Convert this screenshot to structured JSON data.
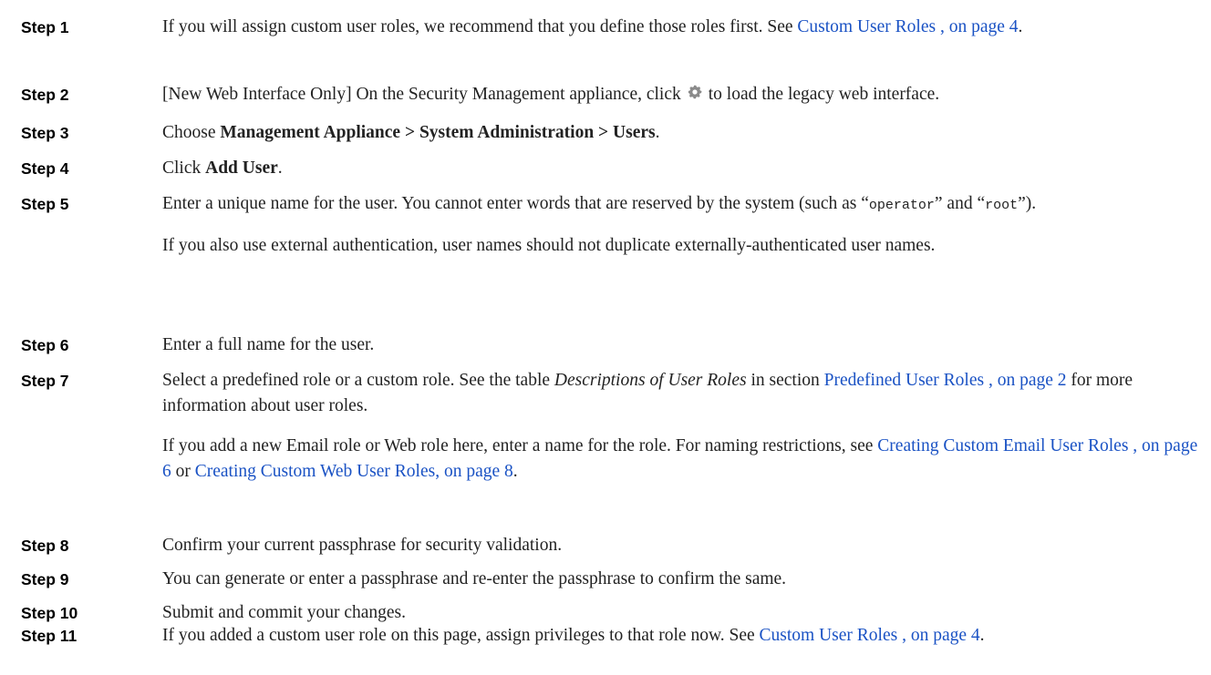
{
  "steps": [
    {
      "label": "Step 1",
      "p1": {
        "a": "If you will assign custom user roles, we recommend that you define those roles first. See ",
        "link": "Custom User Roles , on page 4",
        "b": "."
      }
    },
    {
      "label": "Step 2",
      "p1": {
        "a": "[New Web Interface Only] On the Security Management appliance, click",
        "b": "to load the legacy web interface."
      }
    },
    {
      "label": "Step 3",
      "p1": {
        "a": "Choose ",
        "bold": "Management Appliance > System Administration > Users",
        "b": "."
      }
    },
    {
      "label": "Step 4",
      "p1": {
        "a": "Click ",
        "bold": "Add User",
        "b": "."
      }
    },
    {
      "label": "Step 5",
      "p1": {
        "a": "Enter a unique name for the user. You cannot enter words that are reserved by the system (such as “",
        "code1": "operator",
        "b": "” and “",
        "code2": "root",
        "c": "”)."
      },
      "p2": "If you also use external authentication, user names should not duplicate externally-authenticated user names."
    },
    {
      "label": "Step 6",
      "p1": "Enter a full name for the user."
    },
    {
      "label": "Step 7",
      "p1": {
        "a": "Select a predefined role or a custom role. See the table ",
        "italic": "Descriptions of User Roles",
        "b": " in section ",
        "link": "Predefined User Roles , on page 2",
        "c": " for more information about user roles."
      },
      "p2": {
        "a": "If you add a new Email role or Web role here, enter a name for the role. For naming restrictions, see ",
        "link1": "Creating Custom Email User Roles , on page 6",
        "b": " or ",
        "link2": "Creating Custom Web User Roles, on page 8",
        "c": "."
      }
    },
    {
      "label": "Step 8",
      "p1": "Confirm your current passphrase for security validation."
    },
    {
      "label": "Step 9",
      "p1": "You can generate or enter a passphrase and re-enter the passphrase to confirm the same."
    },
    {
      "label": "Step 10",
      "p1": "Submit and commit your changes."
    },
    {
      "label": "Step 11",
      "p1": {
        "a": "If you added a custom user role on this page, assign privileges to that role now. See ",
        "link": "Custom User Roles , on page 4",
        "b": "."
      }
    }
  ],
  "icons": {
    "settings": "gear-icon"
  },
  "colors": {
    "link": "#1a52c4",
    "text": "#222222"
  }
}
